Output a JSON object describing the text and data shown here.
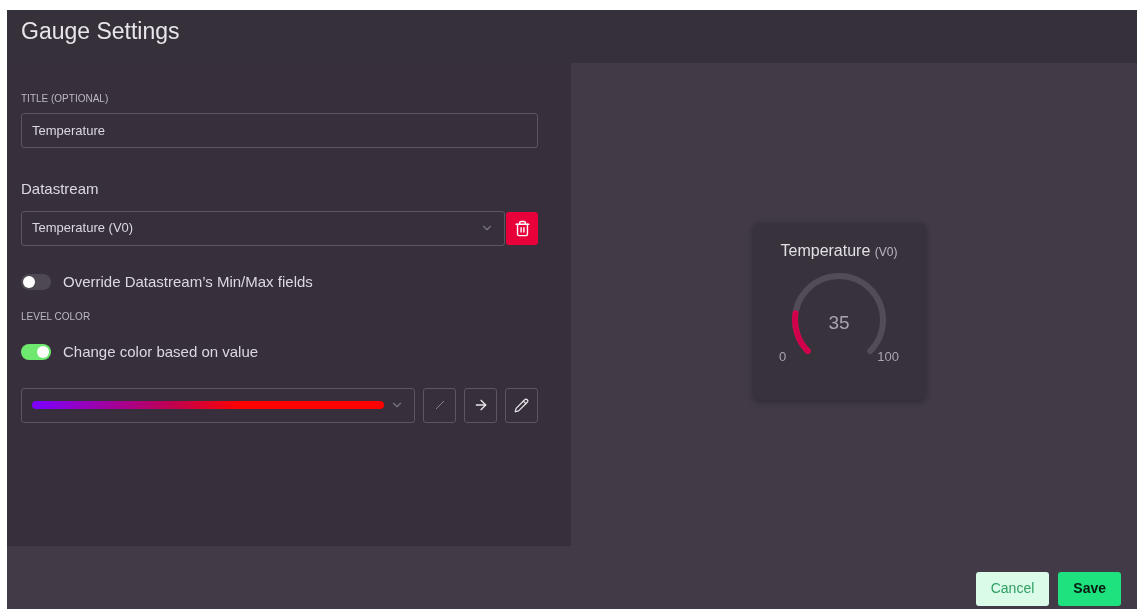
{
  "dialog": {
    "title": "Gauge Settings"
  },
  "title_field": {
    "label": "TITLE (OPTIONAL)",
    "value": "Temperature"
  },
  "datastream": {
    "label": "Datastream",
    "value": "Temperature (V0)"
  },
  "override_toggle": {
    "label": "Override Datastream’s Min/Max fields",
    "on": false
  },
  "level_color": {
    "label": "LEVEL COLOR",
    "toggle": {
      "label": "Change color based on value",
      "on": true
    }
  },
  "preview": {
    "title": "Temperature",
    "pin": "(V0)",
    "value": "35",
    "min": "0",
    "max": "100"
  },
  "buttons": [
    {
      "label": "Cancel",
      "kind": "secondary"
    },
    {
      "label": "Save",
      "kind": "primary"
    }
  ]
}
